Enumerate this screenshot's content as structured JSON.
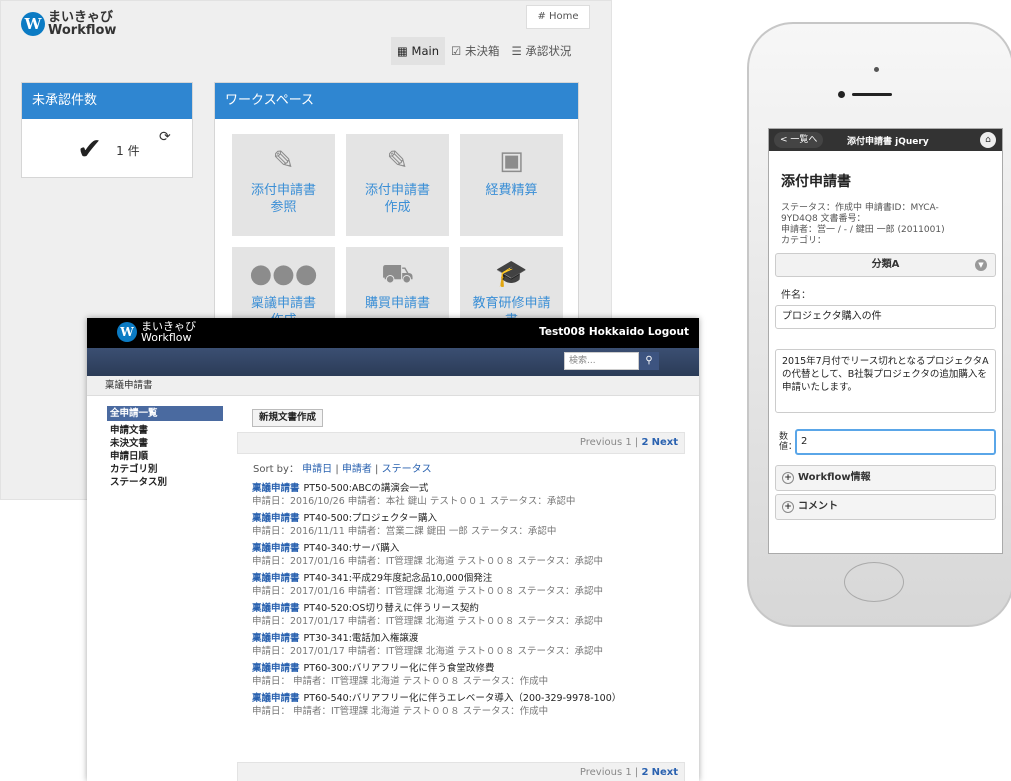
{
  "back": {
    "logo": {
      "mark": "W",
      "line1": "まいきゃび",
      "line2": "Workflow"
    },
    "home": "# Home",
    "nav": [
      "Main",
      "未決箱",
      "承認状況"
    ],
    "pending": {
      "title": "未承認件数",
      "count": "1 件"
    },
    "workspace": {
      "title": "ワークスペース",
      "tiles": [
        {
          "label": "添付申請書\n参照"
        },
        {
          "label": "添付申請書\n作成"
        },
        {
          "label": "経費精算"
        },
        {
          "label": "稟議申請書\n作成"
        },
        {
          "label": "購買申請書"
        },
        {
          "label": "教育研修申請\n書"
        }
      ]
    }
  },
  "list": {
    "logo": {
      "mark": "W",
      "line1": "まいきゃび",
      "line2": "Workflow"
    },
    "user": "Test008 Hokkaido  Logout",
    "search_placeholder": "検索...",
    "breadcrumb": "稟議申請書",
    "sidebar": [
      "全申請一覧",
      "申請文書",
      "未決文書",
      "申請日順",
      "カテゴリ別",
      "ステータス別"
    ],
    "new_button": "新規文書作成",
    "pager": {
      "prev": "Previous",
      "p1": "1",
      "p2": "2",
      "next": "Next"
    },
    "sort": {
      "label": "Sort by：",
      "opts": [
        "申請日",
        "申請者",
        "ステータス"
      ]
    },
    "items": [
      {
        "type": "稟議申請書",
        "title": "PT50-500:ABCの講演会一式",
        "meta": "申請日：2016/10/26  申請者：本社  鍵山 テスト００１  ステータス：承認中"
      },
      {
        "type": "稟議申請書",
        "title": "PT40-500:プロジェクター購入",
        "meta": "申請日：2016/11/11  申請者：営業二課  鍵田 一郎  ステータス：承認中"
      },
      {
        "type": "稟議申請書",
        "title": "PT40-340:サーバ購入",
        "meta": "申請日：2017/01/16  申請者：IT管理課  北海道 テスト００８  ステータス：承認中"
      },
      {
        "type": "稟議申請書",
        "title": "PT40-341:平成29年度記念品10,000個発注",
        "meta": "申請日：2017/01/16  申請者：IT管理課  北海道 テスト００８  ステータス：承認中"
      },
      {
        "type": "稟議申請書",
        "title": "PT40-520:OS切り替えに伴うリース契約",
        "meta": "申請日：2017/01/17  申請者：IT管理課  北海道 テスト００８  ステータス：承認中"
      },
      {
        "type": "稟議申請書",
        "title": "PT30-341:電話加入権譲渡",
        "meta": "申請日：2017/01/17  申請者：IT管理課  北海道 テスト００８  ステータス：承認中"
      },
      {
        "type": "稟議申請書",
        "title": "PT60-300:バリアフリー化に伴う食堂改修費",
        "meta": "申請日：  申請者：IT管理課  北海道 テスト００８  ステータス：作成中"
      },
      {
        "type": "稟議申請書",
        "title": "PT60-540:バリアフリー化に伴うエレベータ導入（200-329-9978-100）",
        "meta": "申請日：  申請者：IT管理課  北海道 テスト００８  ステータス：作成中"
      }
    ]
  },
  "phone": {
    "back": "< 一覧へ",
    "title": "添付申請書 jQuery",
    "heading": "添付申請書",
    "status": [
      "ステータス：作成中 申請書ID：MYCA-",
      "9YD4Q8 文書番号：",
      "申請者：営一 / - / 鍵田 一郎 (2011001)",
      "カテゴリ："
    ],
    "category": "分類A",
    "subject_label": "件名：",
    "subject": "プロジェクタ購入の件",
    "body": "2015年7月付でリース切れとなるプロジェクタAの代替として、B社製プロジェクタの追加購入を申請いたします。",
    "qty_label": "数値：",
    "qty": "2",
    "sections": [
      "Workflow情報",
      "コメント"
    ]
  }
}
